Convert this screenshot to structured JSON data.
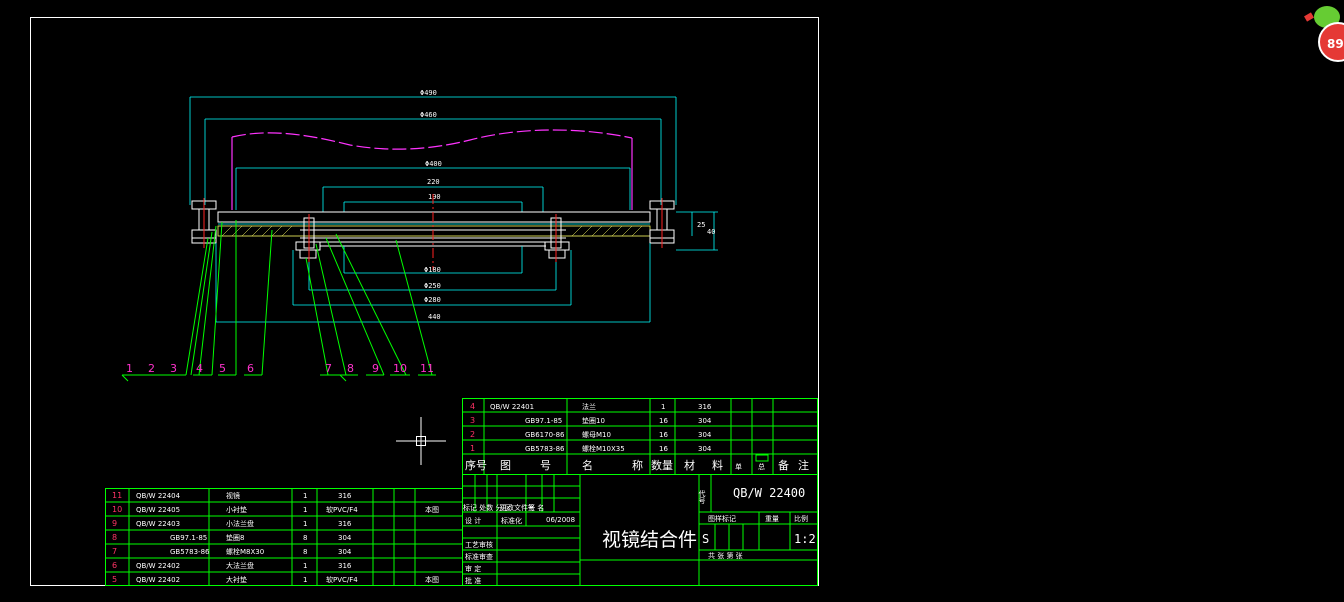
{
  "drawing": {
    "dimensions": {
      "d490": "Φ490",
      "d460": "Φ460",
      "d400": "Φ400",
      "w220": "220",
      "w190": "190",
      "d180": "Φ180",
      "d250": "Φ250",
      "d280": "Φ280",
      "w440": "440",
      "h25": "25",
      "h40": "40"
    },
    "balloons": [
      "1",
      "2",
      "3",
      "4",
      "5",
      "6",
      "7",
      "8",
      "9",
      "10",
      "11"
    ]
  },
  "bom_top": {
    "rows": [
      {
        "no": "4",
        "code": "QB/W 22401",
        "name": "法兰",
        "qty": "1",
        "material": "316"
      },
      {
        "no": "3",
        "code": "GB97.1-85",
        "name": "垫圈10",
        "qty": "16",
        "material": "304"
      },
      {
        "no": "2",
        "code": "GB6170-86",
        "name": "螺母M10",
        "qty": "16",
        "material": "304"
      },
      {
        "no": "1",
        "code": "GB5783-86",
        "name": "螺栓M10X35",
        "qty": "16",
        "material": "304"
      }
    ],
    "header": [
      "序号",
      "图",
      "号",
      "名",
      "称",
      "数量",
      "材",
      "料",
      "单",
      "总",
      "备",
      "注"
    ]
  },
  "bom_bottom": {
    "rows": [
      {
        "no": "11",
        "code": "QB/W 22404",
        "name": "视镜",
        "qty": "1",
        "material": "316",
        "note": ""
      },
      {
        "no": "10",
        "code": "QB/W 22405",
        "name": "小衬垫",
        "qty": "1",
        "material": "软PVC/F4",
        "note": "本图"
      },
      {
        "no": "9",
        "code": "QB/W 22403",
        "name": "小法兰盘",
        "qty": "1",
        "material": "316",
        "note": ""
      },
      {
        "no": "8",
        "code": "GB97.1-85",
        "name": "垫圈8",
        "qty": "8",
        "material": "304",
        "note": ""
      },
      {
        "no": "7",
        "code": "GB5783-86",
        "name": "螺栓M8X30",
        "qty": "8",
        "material": "304",
        "note": ""
      },
      {
        "no": "6",
        "code": "QB/W 22402",
        "name": "大法兰盘",
        "qty": "1",
        "material": "316",
        "note": ""
      },
      {
        "no": "5",
        "code": "QB/W 22402",
        "name": "大衬垫",
        "qty": "1",
        "material": "软PVC/F4",
        "note": "本图"
      }
    ]
  },
  "title_block": {
    "title": "视镜结合件",
    "code_label": "代号",
    "drawing_code": "QB/W 22400",
    "scale": "1:2",
    "stage": "S",
    "date": "06/2008",
    "labels": {
      "design": "设 计",
      "standard": "标准化",
      "sign": "签 名",
      "process": "工艺审核",
      "check": "标准审查",
      "review": "审 定",
      "approve": "批 准",
      "marks": "标记 处数 分 区",
      "change": "更改文件号",
      "stage_hdr": "图样标记",
      "weight": "重量",
      "scale_hdr": "比例",
      "sheet": "共 张 第 张"
    }
  },
  "badge": {
    "value": "89"
  }
}
